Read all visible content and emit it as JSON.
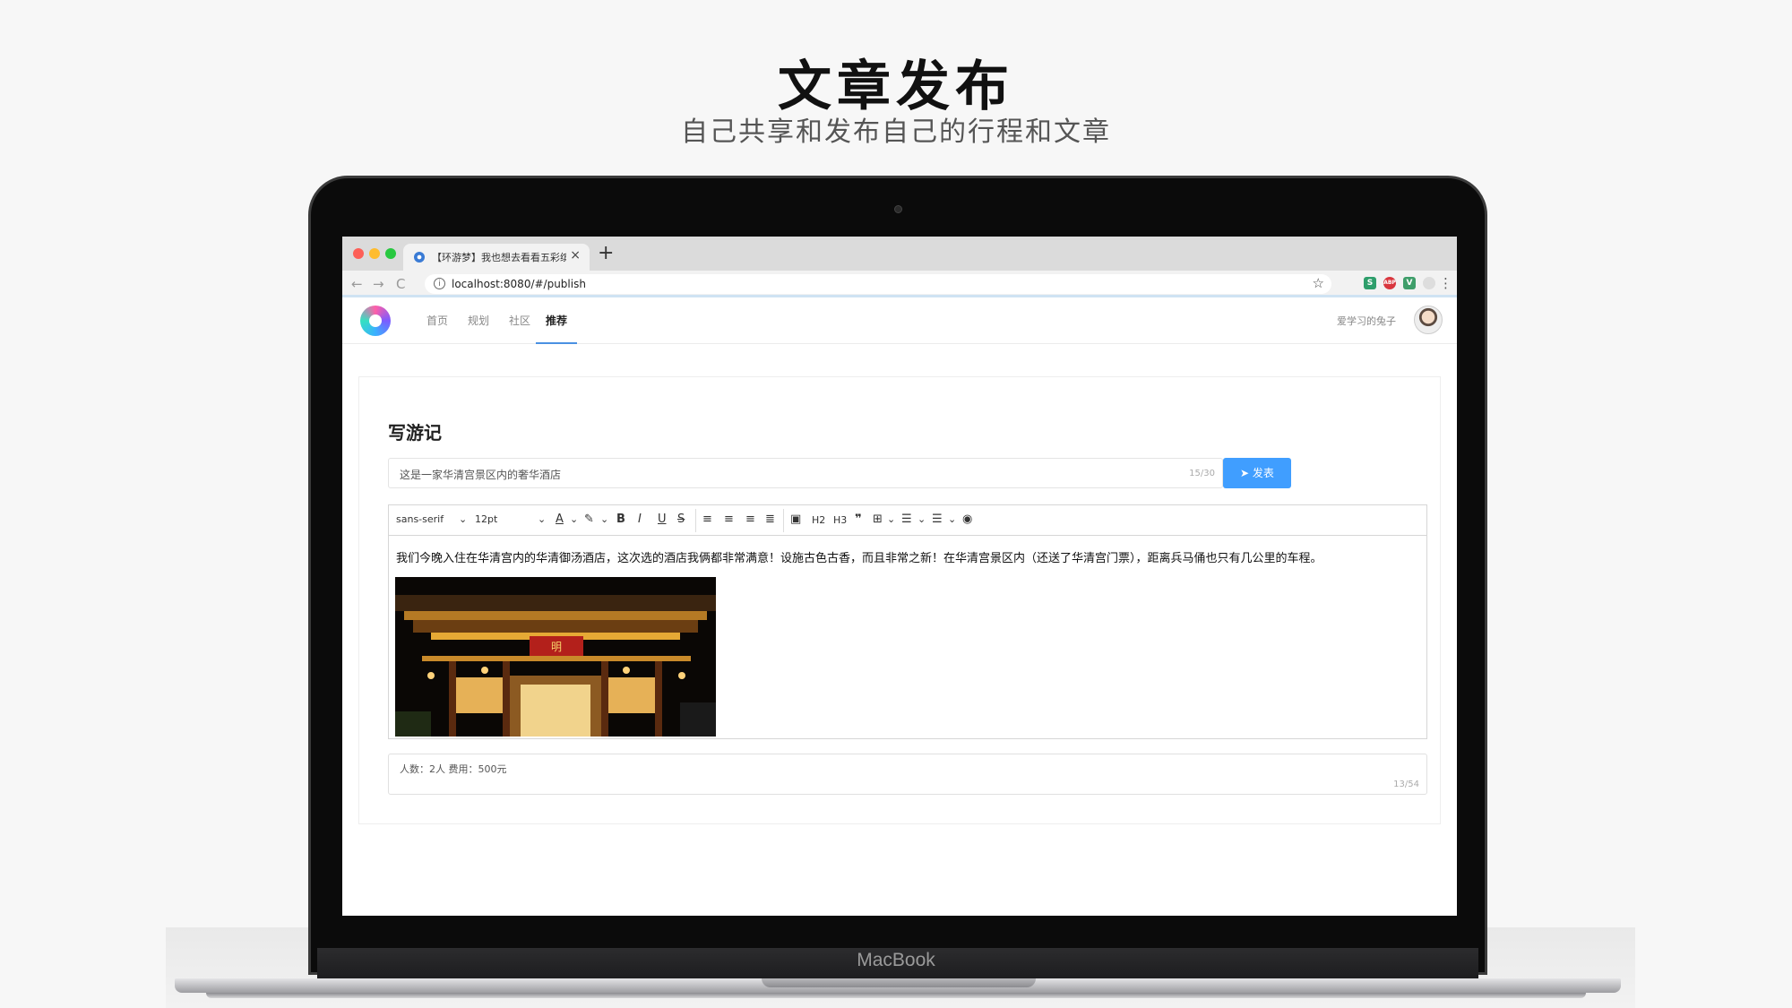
{
  "hero": {
    "title": "文章发布",
    "subtitle": "自己共享和发布自己的行程和文章"
  },
  "device": {
    "label": "MacBook"
  },
  "browser": {
    "tab_title": "【环游梦】我也想去看看五彩缤纷",
    "tab_close": "×",
    "new_tab": "+",
    "url": "localhost:8080/#/publish",
    "back": "←",
    "forward": "→",
    "reload": "C",
    "bookmark": "☆",
    "menu": "⋮",
    "extensions": [
      {
        "icon": "s-extension-icon",
        "text": "S",
        "color": "#2e9e6b"
      },
      {
        "icon": "abp-extension-icon",
        "text": "ABP",
        "color": "#d9363e"
      },
      {
        "icon": "vue-devtools-icon",
        "text": "V",
        "color": "#3f9e6a"
      }
    ]
  },
  "app_nav": {
    "items": [
      {
        "label": "首页",
        "active": false
      },
      {
        "label": "规划",
        "active": false
      },
      {
        "label": "社区",
        "active": false
      },
      {
        "label": "推荐",
        "active": true
      }
    ],
    "username": "爱学习的兔子"
  },
  "editor_page": {
    "heading": "写游记",
    "title_value": "这是一家华清宫景区内的奢华酒店",
    "title_counter": "15/30",
    "publish_label": "发表",
    "toolbar": {
      "font_family": "sans-serif",
      "font_size": "12pt",
      "h2": "H2",
      "h3": "H3"
    },
    "content": "我们今晚入住在华清宫内的华清御汤酒店，这次选的酒店我俩都非常满意！设施古色古香，而且非常之新！在华清宫景区内（还送了华清宫门票），距离兵马俑也只有几公里的车程。",
    "image_sign": "明",
    "note_value": "人数：2人 费用：500元",
    "note_counter": "13/54"
  },
  "colors": {
    "accent": "#409eff",
    "nav_active_underline": "#4a90e2"
  }
}
